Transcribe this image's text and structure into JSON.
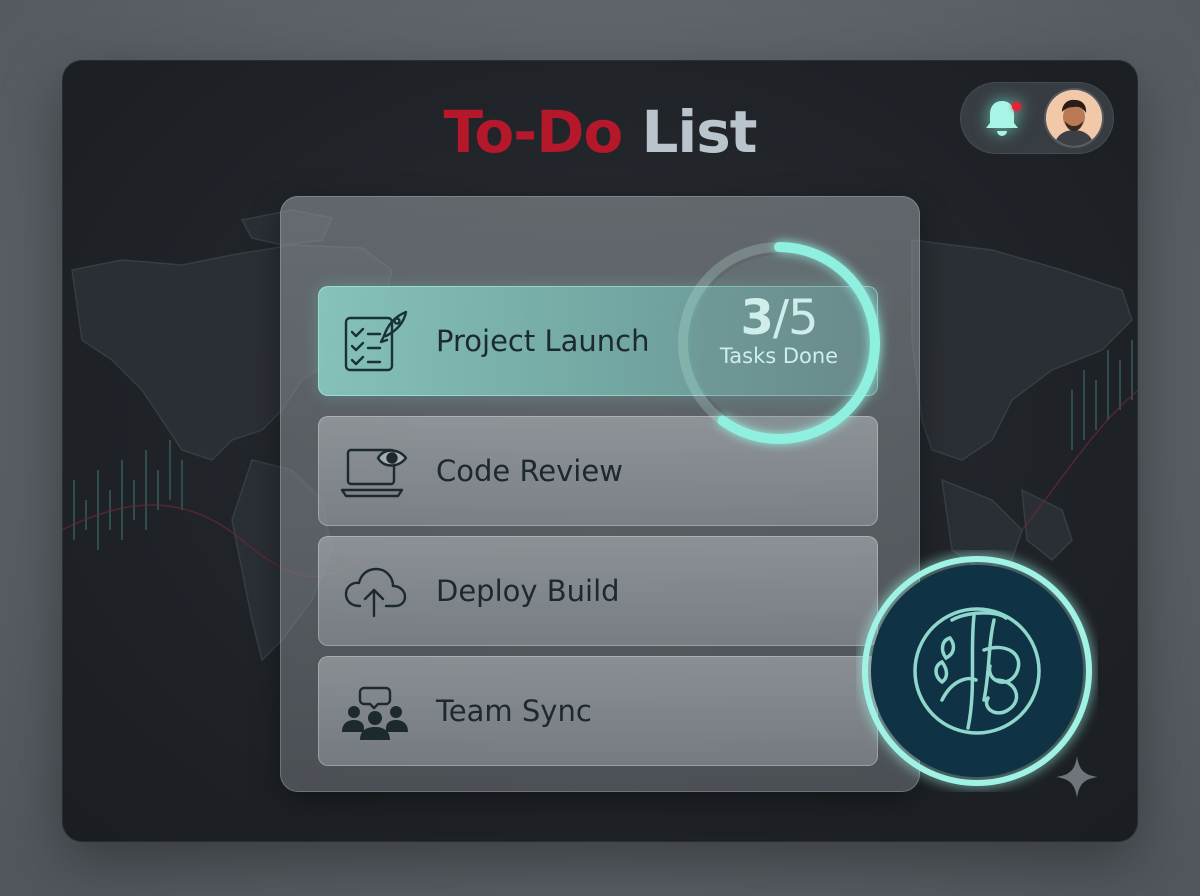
{
  "header": {
    "title_part1": "To-Do",
    "title_part2": "List"
  },
  "icons": {
    "bell": "bell-icon",
    "notification_dot_color": "#e0243a",
    "avatar": "avatar"
  },
  "progress": {
    "completed": "3",
    "separator": "/",
    "total": "5",
    "label": "Tasks Done",
    "fraction": 0.6,
    "ring_color": "#8ff0e0"
  },
  "tasks": [
    {
      "label": "Project Launch",
      "icon": "checklist-rocket-icon",
      "active": true
    },
    {
      "label": "Code Review",
      "icon": "laptop-eye-icon",
      "active": false
    },
    {
      "label": "Deploy Build",
      "icon": "cloud-upload-icon",
      "active": false
    },
    {
      "label": "Team Sync",
      "icon": "team-icon",
      "active": false
    }
  ],
  "colors": {
    "title_accent": "#b4182a",
    "title_secondary": "#b9c4cc",
    "glow": "#8ff0e0"
  }
}
